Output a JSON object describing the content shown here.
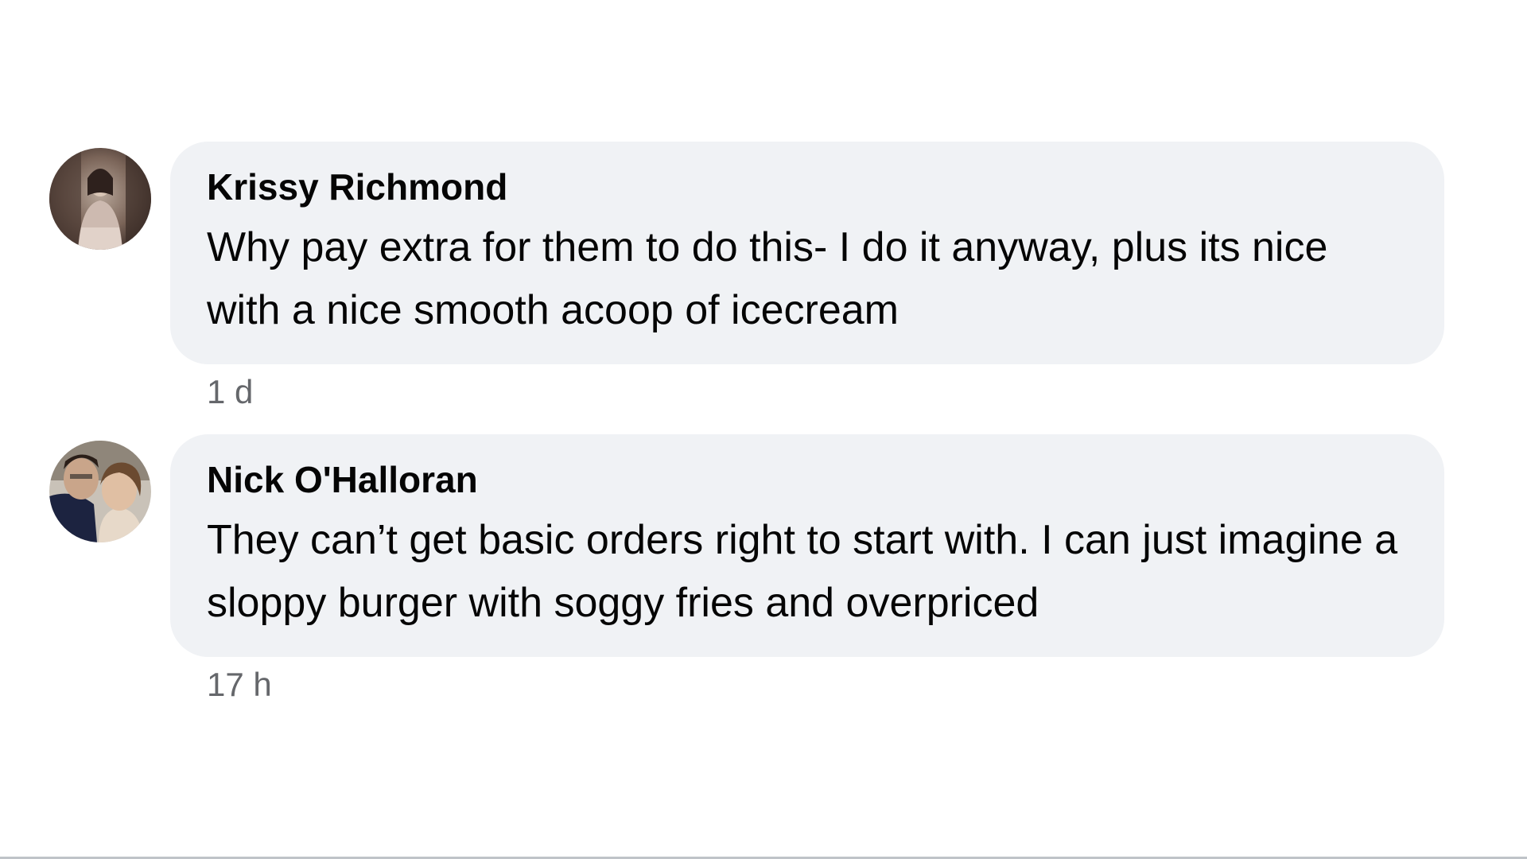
{
  "comments": [
    {
      "author": "Krissy Richmond",
      "text": "Why pay extra for them to do this- I do it anyway, plus its nice with a nice smooth acoop of icecream",
      "time": "1 d"
    },
    {
      "author": "Nick O'Halloran",
      "text": "They can’t get basic orders right to start with. I can just imagine a sloppy burger with soggy fries and overpriced",
      "time": "17 h"
    }
  ]
}
